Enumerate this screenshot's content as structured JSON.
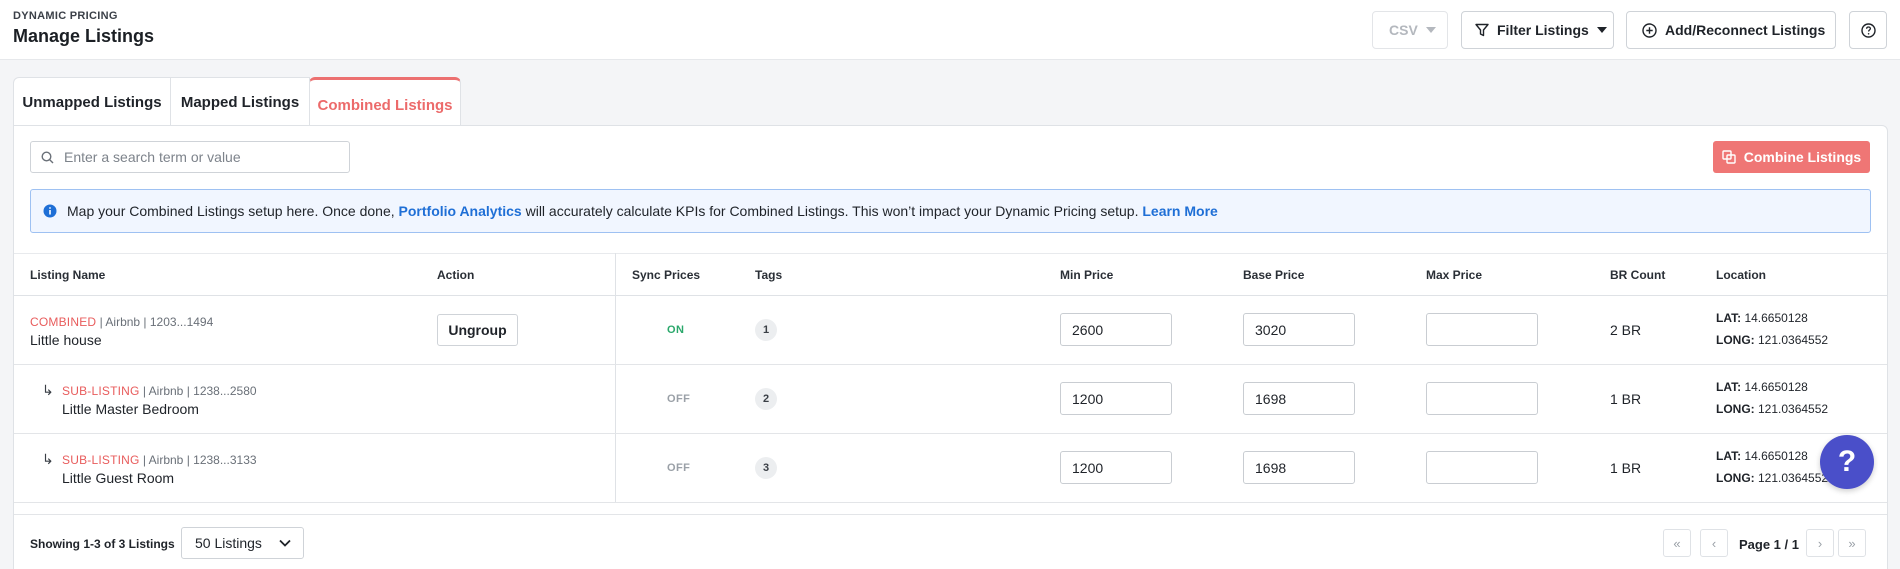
{
  "header": {
    "eyebrow": "DYNAMIC PRICING",
    "title": "Manage Listings",
    "csv_label": "CSV",
    "filter_label": "Filter Listings",
    "add_label": "Add/Reconnect Listings"
  },
  "tabs": [
    {
      "label": "Unmapped Listings"
    },
    {
      "label": "Mapped Listings"
    },
    {
      "label": "Combined Listings",
      "active": true
    }
  ],
  "search": {
    "placeholder": "Enter a search term or value"
  },
  "combine_button": "Combine Listings",
  "info": {
    "text_before": "Map your Combined Listings setup here. Once done, ",
    "link1": "Portfolio Analytics",
    "text_after": " will accurately calculate KPIs for Combined Listings. This won’t impact your Dynamic Pricing setup. ",
    "link2": "Learn More"
  },
  "columns": [
    "Listing Name",
    "Action",
    "Sync Prices",
    "Tags",
    "Min Price",
    "Base Price",
    "Max Price",
    "BR Count",
    "Location"
  ],
  "rows": [
    {
      "kind": "COMBINED",
      "meta": " | Airbnb | 1203...1494",
      "name": "Little house",
      "action": "Ungroup",
      "sync": "ON",
      "tags": "1",
      "min": "2600",
      "base": "3020",
      "max": "",
      "br": "2 BR",
      "lat_label": "LAT:",
      "lat": " 14.6650128",
      "long_label": "LONG:",
      "long": " 121.0364552"
    },
    {
      "arrow": "↳",
      "kind": "SUB-LISTING",
      "meta": " | Airbnb | 1238...2580",
      "name": "Little Master Bedroom",
      "sync": "OFF",
      "tags": "2",
      "min": "1200",
      "base": "1698",
      "max": "",
      "br": "1 BR",
      "lat_label": "LAT:",
      "lat": " 14.6650128",
      "long_label": "LONG:",
      "long": " 121.0364552"
    },
    {
      "arrow": "↳",
      "kind": "SUB-LISTING",
      "meta": " | Airbnb | 1238...3133",
      "name": "Little Guest Room",
      "sync": "OFF",
      "tags": "3",
      "min": "1200",
      "base": "1698",
      "max": "",
      "br": "1 BR",
      "lat_label": "LAT:",
      "lat": " 14.6650128",
      "long_label": "LONG:",
      "long": " 121.0364552"
    }
  ],
  "footer": {
    "showing": "Showing 1-3 of 3 Listings",
    "per_page": "50 Listings",
    "page_label": "Page 1 / 1",
    "first": "«",
    "prev": "‹",
    "next": "›",
    "last": "»"
  },
  "float_help": "?",
  "colors": {
    "accent": "#ef7675",
    "link": "#1f6fd6",
    "on": "#2aa86b",
    "help": "#4a4fc9"
  }
}
